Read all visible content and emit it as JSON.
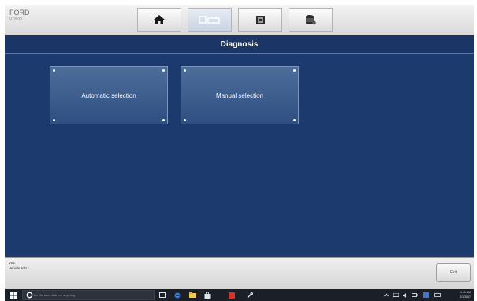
{
  "vehicle": {
    "make": "FORD",
    "version": "V18.90"
  },
  "toolbar": {
    "tabs": [
      {
        "name": "home",
        "icon": "home-icon"
      },
      {
        "name": "diagnose",
        "icon": "vehicle-diagnose-icon"
      },
      {
        "name": "screenshot",
        "icon": "screenshot-icon"
      },
      {
        "name": "data",
        "icon": "data-log-icon"
      }
    ]
  },
  "page": {
    "title": "Diagnosis"
  },
  "options": [
    {
      "label": "Automatic selection"
    },
    {
      "label": "Manual selection"
    }
  ],
  "status": {
    "vin_label": "VIN:",
    "vehicle_info_label": "Vehicle Info.:",
    "exit_label": "Exit"
  },
  "taskbar": {
    "search_placeholder": "I'm Cortana. Ask me anything.",
    "time": "1:41 AM",
    "date": "2/1/2017"
  },
  "colors": {
    "background": "#1c3a6e",
    "title_bar": "#1a3566",
    "tile": "#3d5d8e"
  }
}
